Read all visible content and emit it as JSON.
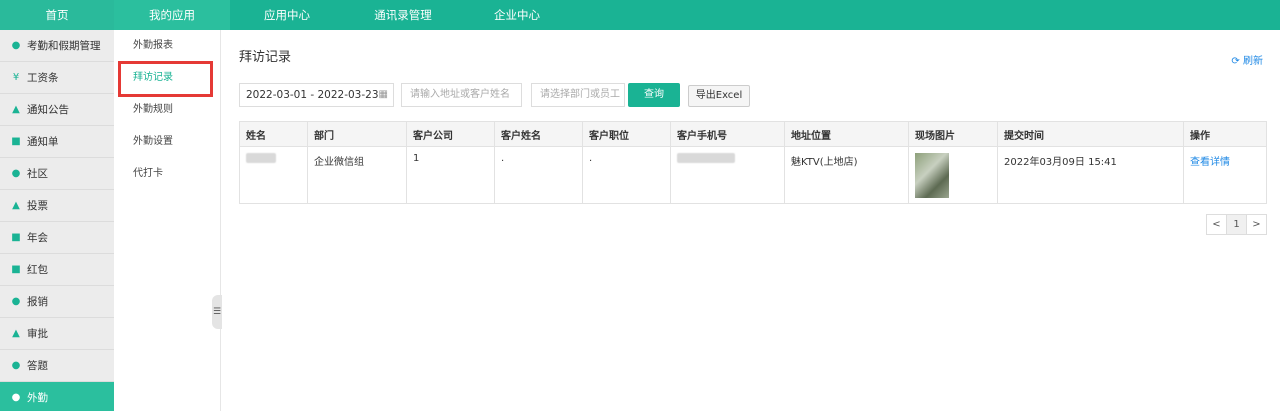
{
  "topnav": {
    "home": "首页",
    "my_apps": "我的应用",
    "app_center": "应用中心",
    "contacts": "通讯录管理",
    "enterprise": "企业中心"
  },
  "sidebar": {
    "items": [
      {
        "label": "考勤和假期管理",
        "icon": "clock-icon"
      },
      {
        "label": "工资条",
        "icon": "yuan-icon"
      },
      {
        "label": "通知公告",
        "icon": "bell-icon"
      },
      {
        "label": "通知单",
        "icon": "document-icon"
      },
      {
        "label": "社区",
        "icon": "chat-icon"
      },
      {
        "label": "投票",
        "icon": "vote-icon"
      },
      {
        "label": "年会",
        "icon": "card-icon"
      },
      {
        "label": "红包",
        "icon": "red-packet-icon"
      },
      {
        "label": "报销",
        "icon": "coin-icon"
      },
      {
        "label": "审批",
        "icon": "user-check-icon"
      },
      {
        "label": "答题",
        "icon": "link-icon"
      },
      {
        "label": "外勤",
        "icon": "location-pin-icon"
      }
    ]
  },
  "submenu": {
    "items": [
      "外勤报表",
      "拜访记录",
      "外勤规则",
      "外勤设置",
      "代打卡"
    ]
  },
  "main": {
    "title": "拜访记录",
    "refresh": "刷新",
    "date_range": "2022-03-01 - 2022-03-23",
    "addr_placeholder": "请输入地址或客户姓名",
    "dept_placeholder": "请选择部门或员工",
    "query_label": "查询",
    "export_label": "导出Excel"
  },
  "table": {
    "headers": [
      "姓名",
      "部门",
      "客户公司",
      "客户姓名",
      "客户职位",
      "客户手机号",
      "地址位置",
      "现场图片",
      "提交时间",
      "操作"
    ],
    "rows": [
      {
        "department": "企业微信组",
        "company": "1",
        "customer_name": ".",
        "customer_title": ".",
        "address": "魅KTV(上地店)",
        "time": "2022年03月09日 15:41",
        "action": "查看详情"
      }
    ]
  },
  "pager": {
    "prev": "<",
    "page": "1",
    "next": ">"
  },
  "colors": {
    "accent": "#1ab394",
    "link": "#1e88e5",
    "highlight": "#e53935"
  }
}
